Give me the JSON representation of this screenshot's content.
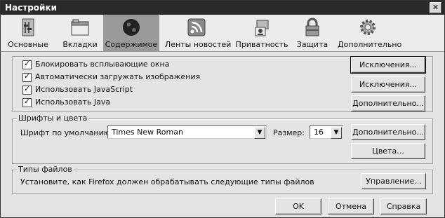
{
  "window": {
    "title": "Настройки",
    "close_glyph": "✕"
  },
  "tabs": [
    {
      "label": "Основные",
      "icon": "general-icon",
      "selected": false
    },
    {
      "label": "Вкладки",
      "icon": "tabs-icon",
      "selected": false
    },
    {
      "label": "Содержимое",
      "icon": "globe-icon",
      "selected": true
    },
    {
      "label": "Ленты новостей",
      "icon": "feed-icon",
      "selected": false
    },
    {
      "label": "Приватность",
      "icon": "privacy-icon",
      "selected": false
    },
    {
      "label": "Защита",
      "icon": "lock-icon",
      "selected": false
    },
    {
      "label": "Дополнительно",
      "icon": "gear-icon",
      "selected": false
    }
  ],
  "content": {
    "popups_label": "Блокировать всплывающие окна",
    "images_label": "Автоматически загружать изображения",
    "javascript_label": "Использовать JavaScript",
    "java_label": "Использовать Java",
    "exceptions1": "Исключения...",
    "exceptions2": "Исключения...",
    "advanced": "Дополнительно...",
    "check_glyph": "✓"
  },
  "fonts": {
    "group_label": "Шрифты и цвета",
    "default_font_label": "Шрифт по умолчанию:",
    "default_font_value": "Times New Roman",
    "size_label": "Размер:",
    "size_value": "16",
    "advanced": "Дополнительно...",
    "colors": "Цвета...",
    "arrow_glyph": "▼"
  },
  "filetypes": {
    "group_label": "Типы файлов",
    "description": "Установите, как Firefox должен обрабатывать следующие типы файлов",
    "manage": "Управление..."
  },
  "footer": {
    "ok": "OK",
    "cancel": "Отмена",
    "help": "Справка"
  }
}
